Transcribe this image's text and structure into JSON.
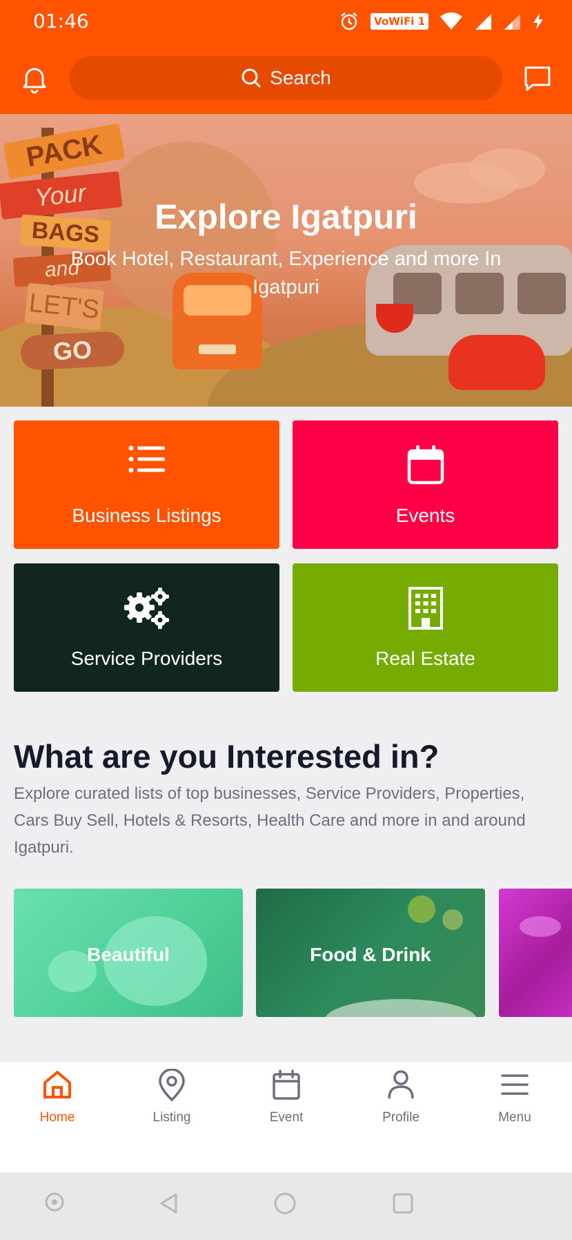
{
  "status_bar": {
    "time": "01:46",
    "wifi_label": "VoWiFi 1"
  },
  "header": {
    "search_placeholder": "Search"
  },
  "hero": {
    "title": "Explore Igatpuri",
    "subtitle": "Book Hotel, Restaurant, Experience and more In Igatpuri",
    "sign_words": [
      "PACK",
      "Your",
      "BAGS",
      "and",
      "LET'S",
      "GO"
    ]
  },
  "tiles": [
    {
      "label": "Business Listings",
      "icon": "list-icon",
      "color": "#ff5300"
    },
    {
      "label": "Events",
      "icon": "calendar-icon",
      "color": "#ff0046"
    },
    {
      "label": "Service Providers",
      "icon": "gears-icon",
      "color": "#11261c"
    },
    {
      "label": "Real Estate",
      "icon": "building-icon",
      "color": "#76ab00"
    }
  ],
  "interests": {
    "title": "What are you Interested in?",
    "description": "Explore curated lists of top businesses, Service Providers, Properties, Cars Buy Sell, Hotels & Resorts, Health Care and more in and around Igatpuri.",
    "cards": [
      {
        "label": "Beautiful",
        "color": "#56d6a0"
      },
      {
        "label": "Food & Drink",
        "color": "#2a7a52"
      },
      {
        "label": "",
        "color": "#c02ab6"
      }
    ]
  },
  "bottom_nav": {
    "items": [
      {
        "label": "Home",
        "icon": "home-icon",
        "active": true
      },
      {
        "label": "Listing",
        "icon": "map-pin-icon",
        "active": false
      },
      {
        "label": "Event",
        "icon": "calendar-icon",
        "active": false
      },
      {
        "label": "Profile",
        "icon": "user-icon",
        "active": false
      },
      {
        "label": "Menu",
        "icon": "menu-icon",
        "active": false
      }
    ]
  },
  "colors": {
    "brand": "#ff5300",
    "nav_inactive": "#6b6f7c"
  }
}
